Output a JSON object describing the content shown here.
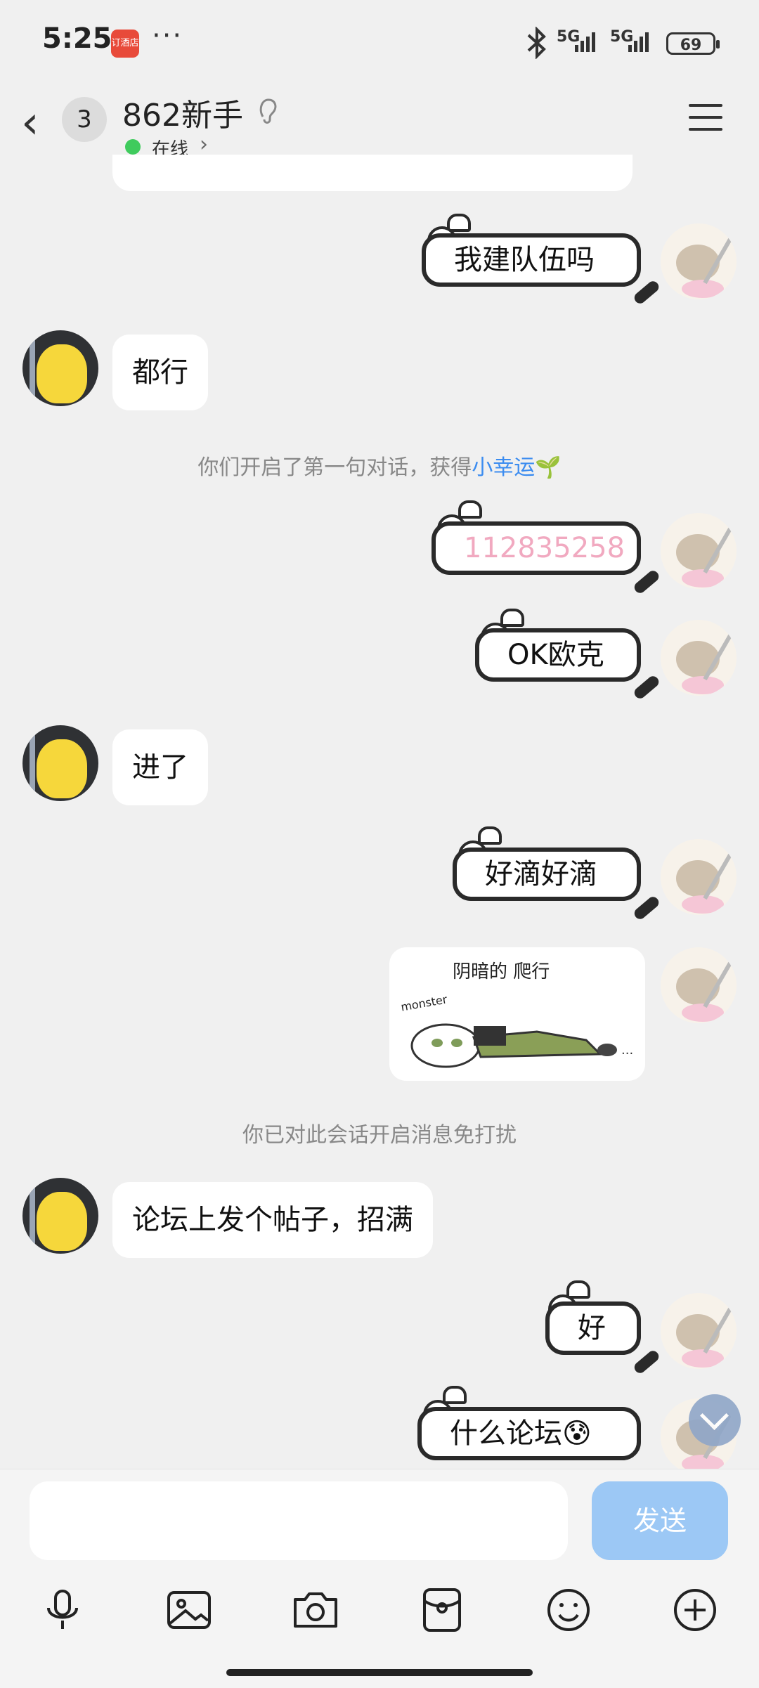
{
  "status_bar": {
    "time": "5:25",
    "app_badge": "订酒店",
    "more": "···",
    "signal1": "5G",
    "signal2": "5G",
    "battery": "69"
  },
  "header": {
    "unread_count": "3",
    "contact_name": "862新手",
    "status": "在线",
    "status_color": "#3fcb5d"
  },
  "messages": {
    "m1": "我建队伍吗",
    "m2": "都行",
    "sys1_prefix": "你们开启了第一句对话，获得",
    "sys1_link": "小幸运",
    "m3": "112835258",
    "m4": "OK欧克",
    "m5": "进了",
    "m6": "好滴好滴",
    "image_caption": "阴暗的 爬行",
    "image_small": "monster",
    "sys2": "你已对此会话开启消息免打扰",
    "m7": "论坛上发个帖子，招满",
    "m8": "好",
    "m9": "什么论坛😰"
  },
  "input": {
    "placeholder": "",
    "send_label": "发送"
  },
  "toolbar_icons": [
    "microphone-icon",
    "image-icon",
    "camera-icon",
    "red-packet-icon",
    "emoji-icon",
    "plus-icon"
  ],
  "colors": {
    "link": "#3b8cf0",
    "send_button": "#9cc8f5",
    "pink_text": "#f1a9c0"
  }
}
